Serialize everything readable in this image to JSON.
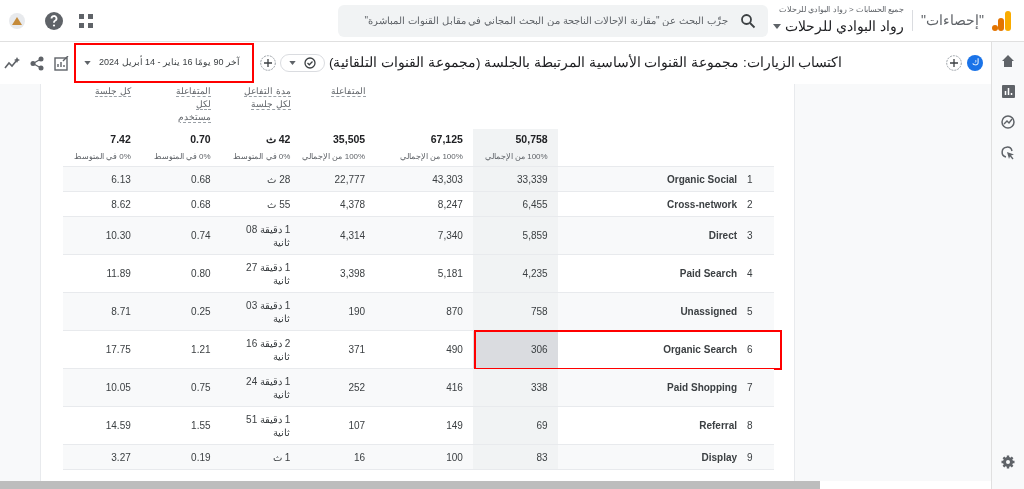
{
  "top_bar": {
    "product": "\"إحصاءات\"",
    "breadcrumb": "جميع الحسابات < رواد البوادي للرحلات",
    "property": "رواد البوادي للرحلات",
    "search": {
      "placeholder": "جرِّب البحث عن \"مقارنة الإحالات الناجحة من البحث المجاني في مقابل القنوات المباشرة\""
    }
  },
  "report_header": {
    "avatar": "ك",
    "title": "اكتساب الزيارات: مجموعة القنوات الأساسية المرتبطة بالجلسة (مجموعة القنوات التلقائية)",
    "date_range": {
      "text": "آخر 90 يومًا 16 يناير - 14 أبريل 2024",
      "highlighted": true
    }
  },
  "table": {
    "columns": [
      {
        "total": "50,758",
        "note": "100% من الإجمالي"
      },
      {
        "total": "67,125",
        "note": "100% من الإجمالي"
      },
      {
        "header": "المتفاعلة",
        "total": "35,505",
        "note": "100% من الإجمالي"
      },
      {
        "header": "مدة التفاعل لكل جلسة",
        "total": "42 ث",
        "note": "0% في المتوسط"
      },
      {
        "header": "المتفاعلة لكل مستخدم",
        "total": "0.70",
        "note": "0% في المتوسط"
      },
      {
        "header": "كل جلسة",
        "total": "7.42",
        "note": "0% في المتوسط"
      }
    ],
    "rows": [
      {
        "index": "1",
        "name": "Organic Social",
        "values": [
          "33,339",
          "43,303",
          "22,777",
          "28 ث",
          "0.68",
          "6.13"
        ],
        "selected": false
      },
      {
        "index": "2",
        "name": "Cross-network",
        "values": [
          "6,455",
          "8,247",
          "4,378",
          "55 ث",
          "0.68",
          "8.62"
        ],
        "selected": false
      },
      {
        "index": "3",
        "name": "Direct",
        "values": [
          "5,859",
          "7,340",
          "4,314",
          "1 دقيقة 08 ثانية",
          "0.74",
          "10.30"
        ],
        "selected": false
      },
      {
        "index": "4",
        "name": "Paid Search",
        "values": [
          "4,235",
          "5,181",
          "3,398",
          "1 دقيقة 27 ثانية",
          "0.80",
          "11.89"
        ],
        "selected": false
      },
      {
        "index": "5",
        "name": "Unassigned",
        "values": [
          "758",
          "870",
          "190",
          "1 دقيقة 03 ثانية",
          "0.25",
          "8.71"
        ],
        "selected": false
      },
      {
        "index": "6",
        "name": "Organic Search",
        "values": [
          "306",
          "490",
          "371",
          "2 دقيقة 16 ثانية",
          "1.21",
          "17.75"
        ],
        "selected": true
      },
      {
        "index": "7",
        "name": "Paid Shopping",
        "values": [
          "338",
          "416",
          "252",
          "1 دقيقة 24 ثانية",
          "0.75",
          "10.05"
        ],
        "selected": false
      },
      {
        "index": "8",
        "name": "Referral",
        "values": [
          "69",
          "149",
          "107",
          "1 دقيقة 51 ثانية",
          "1.55",
          "14.59"
        ],
        "selected": false
      },
      {
        "index": "9",
        "name": "Display",
        "values": [
          "83",
          "100",
          "16",
          "1 ث",
          "0.19",
          "3.27"
        ],
        "selected": false
      }
    ]
  }
}
